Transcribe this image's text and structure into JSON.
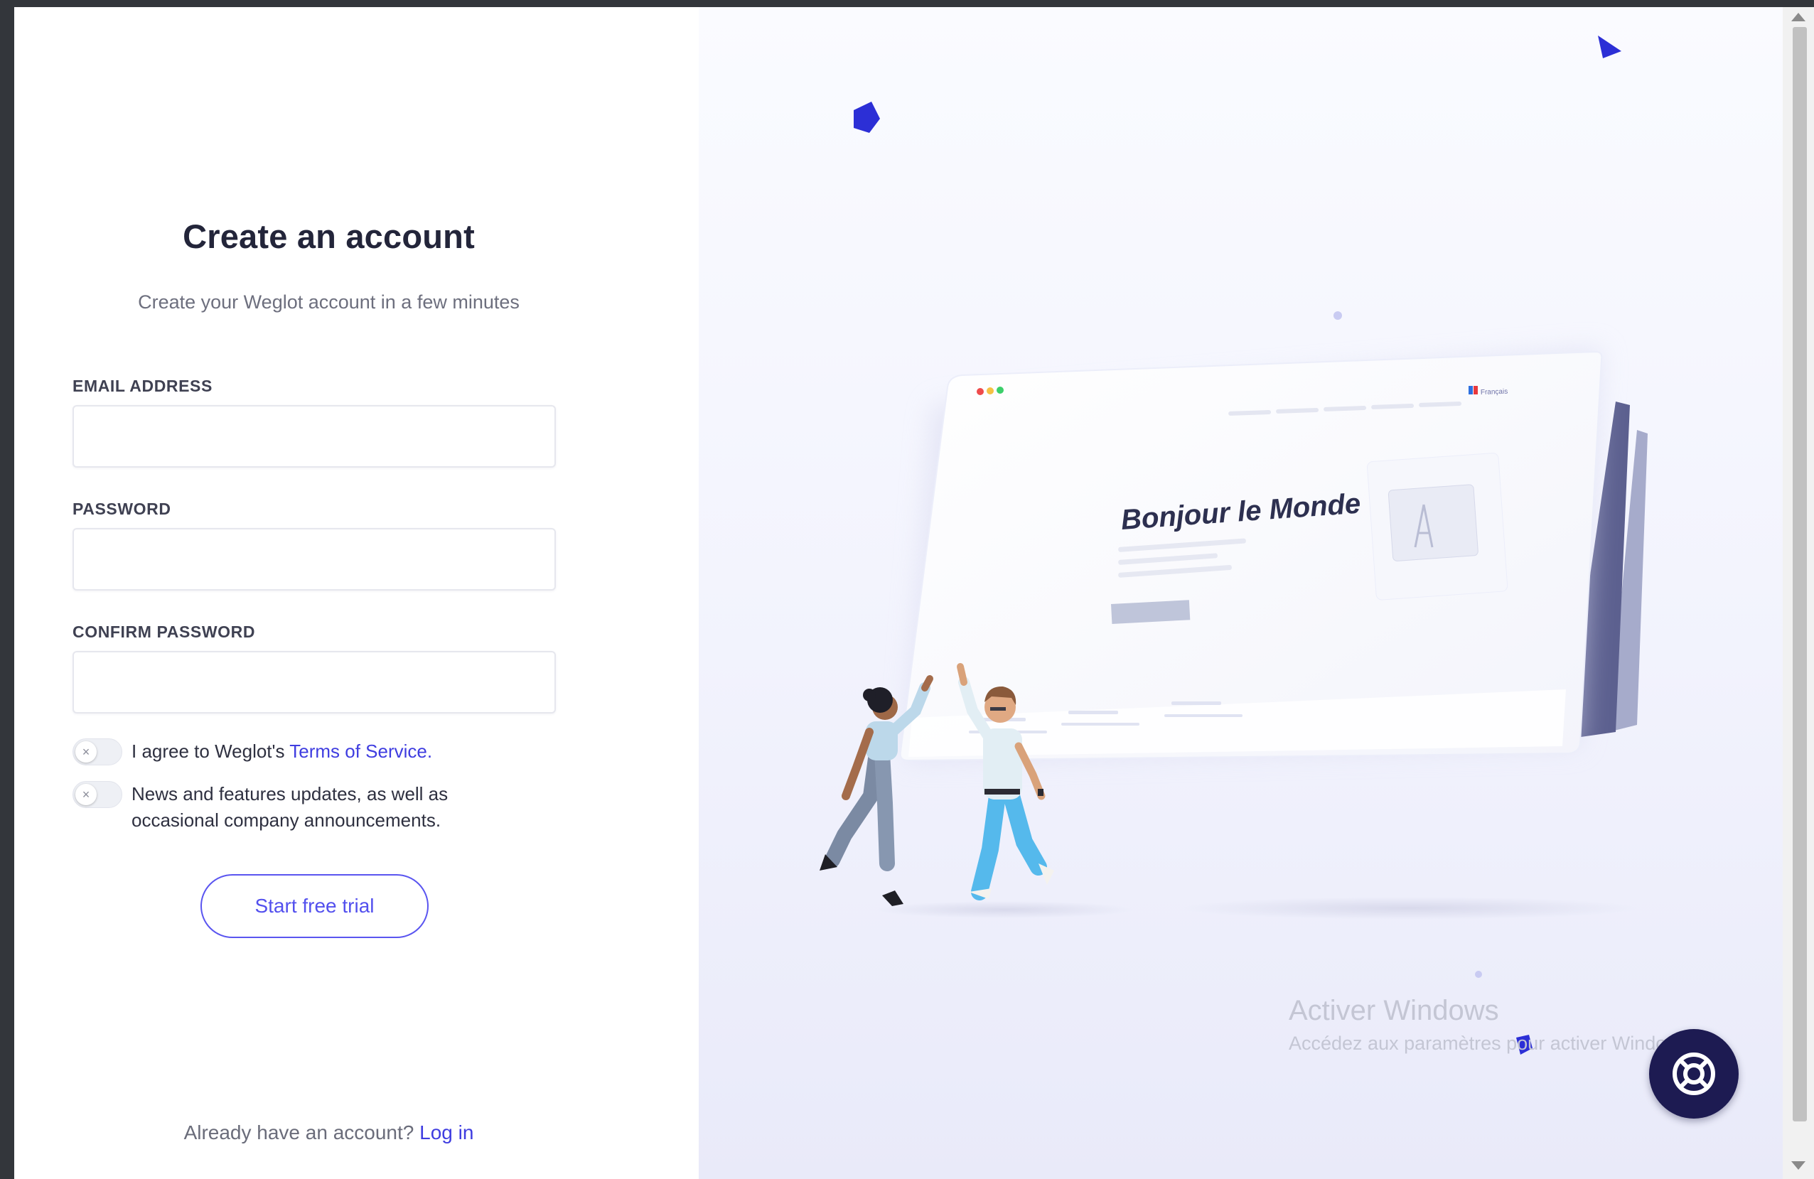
{
  "form": {
    "title": "Create an account",
    "subtitle": "Create your Weglot account in a few minutes",
    "email_label": "EMAIL ADDRESS",
    "email_value": "",
    "password_label": "PASSWORD",
    "password_value": "",
    "confirm_label": "CONFIRM PASSWORD",
    "confirm_value": "",
    "terms_text": "I agree to Weglot's ",
    "terms_link": "Terms of Service.",
    "terms_checked": false,
    "news_text": "News and features updates, as well as occasional company announcements.",
    "news_checked": false,
    "submit_label": "Start free trial",
    "login_prompt": "Already have an account?",
    "login_link": "Log in"
  },
  "illustration": {
    "heading": "Bonjour le Monde !",
    "language_badge": "Français"
  },
  "windows_watermark": {
    "title": "Activer Windows",
    "subtitle": "Accédez aux paramètres pour activer Windows."
  },
  "help_button": {
    "icon": "lifebuoy-icon"
  },
  "colors": {
    "accent": "#5350ee",
    "link": "#3f3de0",
    "help_bg": "#1d1b52",
    "shape_blue": "#2c2fd6"
  }
}
